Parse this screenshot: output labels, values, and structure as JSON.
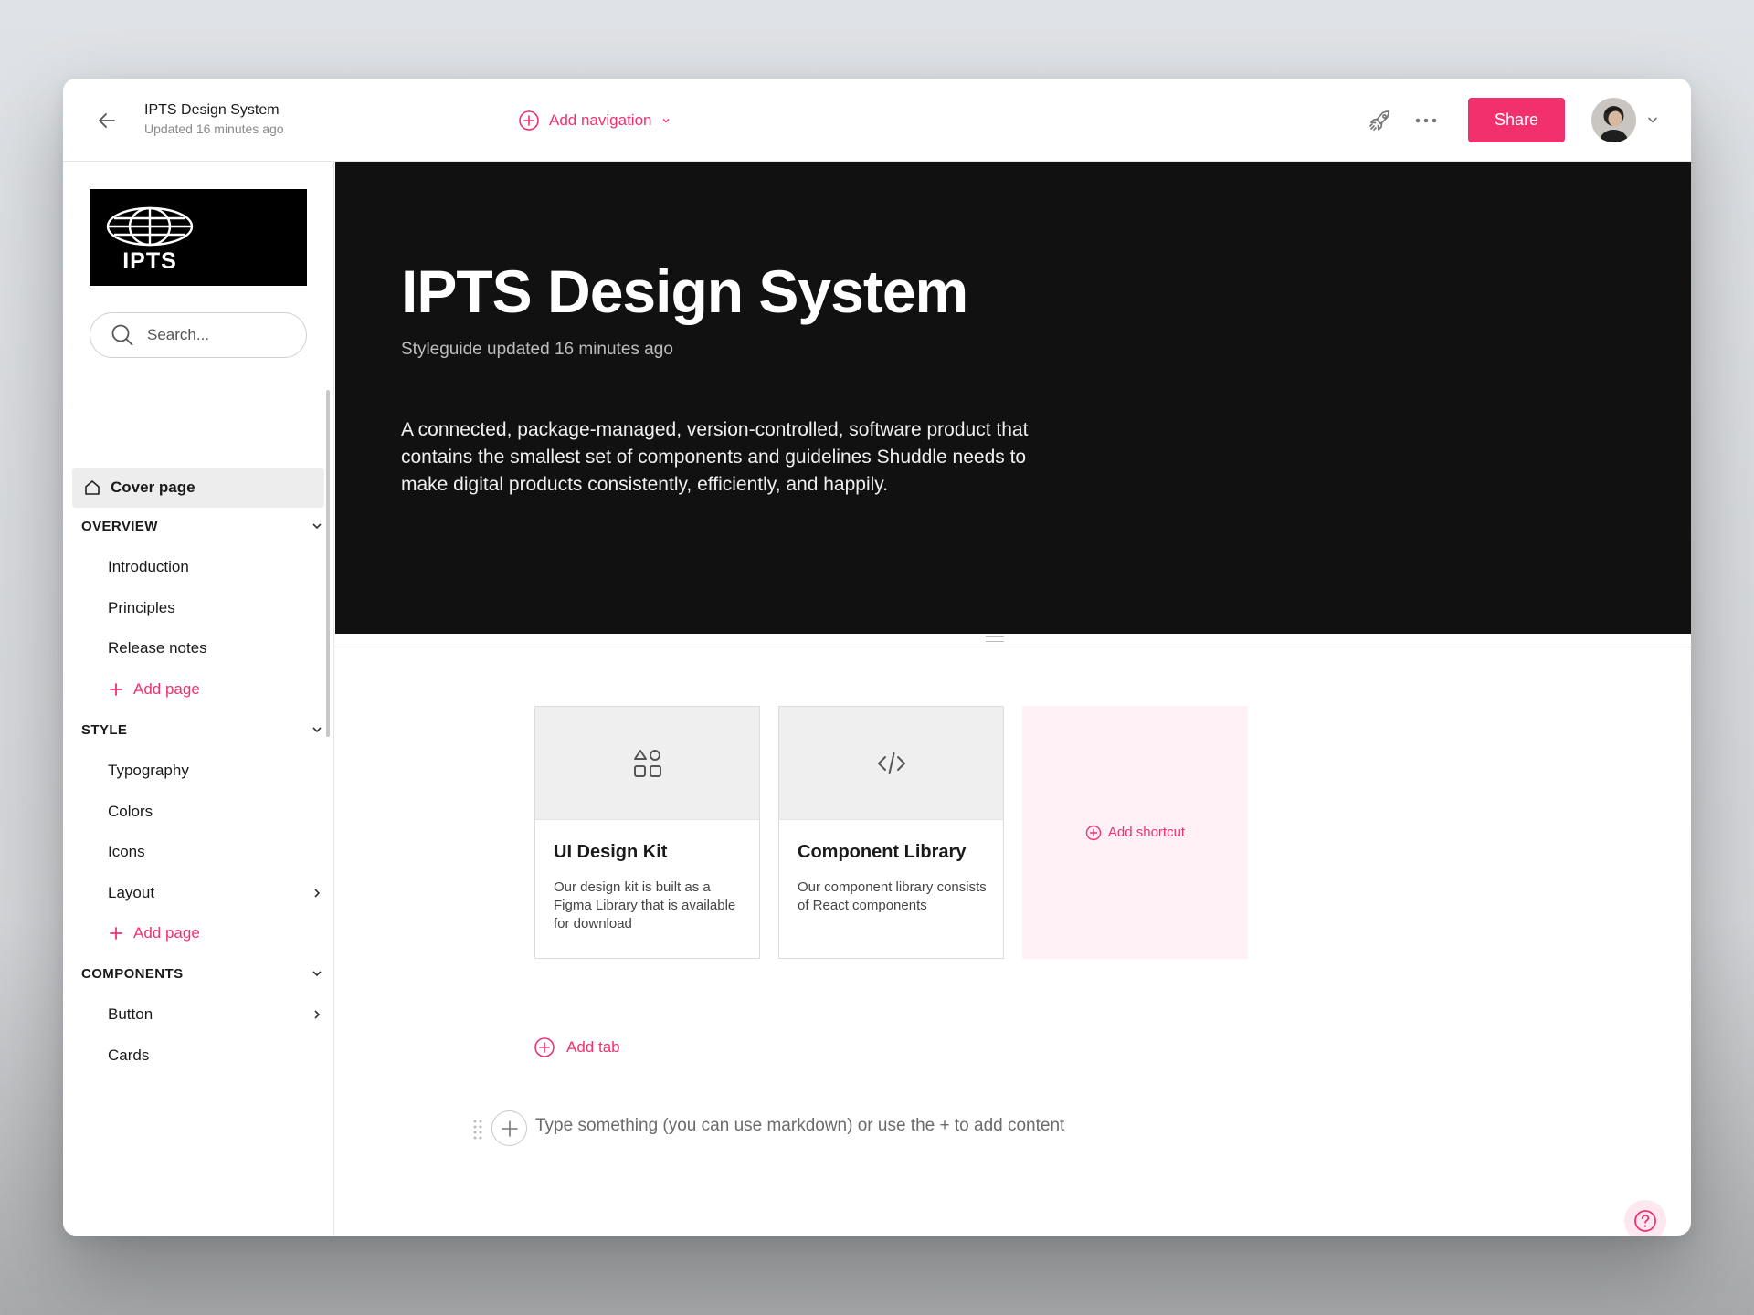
{
  "header": {
    "title": "IPTS Design System",
    "updated": "Updated 16 minutes ago",
    "add_navigation": "Add navigation",
    "share_label": "Share"
  },
  "sidebar": {
    "logo_text": "IPTS",
    "search_placeholder": "Search...",
    "cover": "Cover page",
    "sections": [
      {
        "title": "OVERVIEW",
        "items": [
          "Introduction",
          "Principles",
          "Release notes"
        ],
        "add_label": "Add page"
      },
      {
        "title": "STYLE",
        "items": [
          "Typography",
          "Colors",
          "Icons",
          "Layout"
        ],
        "add_label": "Add page"
      },
      {
        "title": "COMPONENTS",
        "items": [
          "Button",
          "Cards"
        ]
      }
    ]
  },
  "hero": {
    "title": "IPTS Design System",
    "subtitle": "Styleguide updated 16 minutes ago",
    "description": "A connected, package-managed, version-controlled, software product that contains the smallest set of components and guidelines Shuddle needs to make digital products consistently, efficiently, and happily."
  },
  "cards": [
    {
      "icon": "shapes-icon",
      "title": "UI Design Kit",
      "description": "Our design kit is built as a Figma Library that is available for download"
    },
    {
      "icon": "code-icon",
      "title": "Component Library",
      "description": "Our component library consists of React components"
    }
  ],
  "add_shortcut": "Add shortcut",
  "add_tab": "Add tab",
  "editor_placeholder": "Type something (you can use markdown) or use the + to add content",
  "colors": {
    "accent": "#f2306e",
    "hero_bg": "#111111",
    "shortcut_bg": "#fff1f5"
  }
}
